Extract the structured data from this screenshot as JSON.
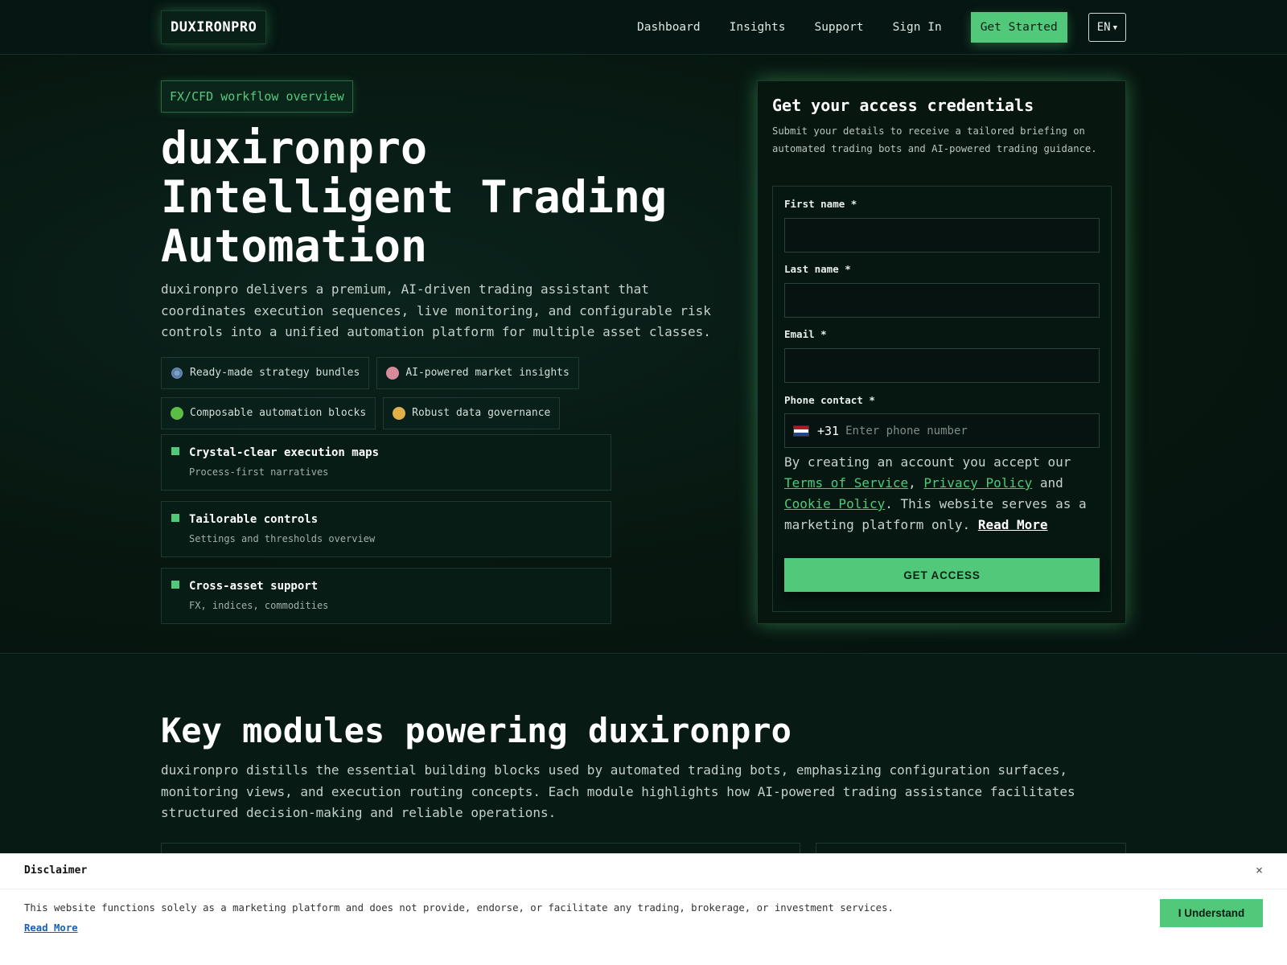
{
  "header": {
    "logo": "DUXIRONPRO",
    "nav": [
      "Dashboard",
      "Insights",
      "Support",
      "Sign In"
    ],
    "cta": "Get Started",
    "lang": "EN"
  },
  "hero": {
    "pill": "FX/CFD workflow overview",
    "title_lines": [
      "duxironpro",
      "Intelligent Trading",
      "Automation"
    ],
    "description": "duxironpro delivers a premium, AI-driven trading assistant that coordinates execution sequences, live monitoring, and configurable risk controls into a unified automation platform for multiple asset classes.",
    "chips": [
      {
        "icon": "gear-icon",
        "label": "Ready-made strategy bundles"
      },
      {
        "icon": "brain-icon",
        "label": "AI-powered market insights"
      },
      {
        "icon": "puzzle-icon",
        "label": "Composable automation blocks"
      },
      {
        "icon": "lock-icon",
        "label": "Robust data governance"
      }
    ],
    "features": [
      {
        "title": "Crystal-clear execution maps",
        "subtitle": "Process-first narratives"
      },
      {
        "title": "Tailorable controls",
        "subtitle": "Settings and thresholds overview"
      },
      {
        "title": "Cross-asset support",
        "subtitle": "FX, indices, commodities"
      }
    ]
  },
  "form": {
    "title": "Get your access credentials",
    "subtitle": "Submit your details to receive a tailored briefing on automated trading bots and AI-powered trading guidance.",
    "first_name_label": "First name *",
    "first_name_value": "",
    "last_name_label": "Last name *",
    "last_name_value": "",
    "email_label": "Email *",
    "email_value": "",
    "phone_label": "Phone contact *",
    "phone_prefix": "+31",
    "phone_placeholder": "Enter phone number",
    "legal_prefix": "By creating an account you accept our",
    "terms": "Terms of Service",
    "comma": ",",
    "privacy": "Privacy Policy",
    "and": "and",
    "cookie": "Cookie Policy",
    "legal_suffix": ". This website serves as a marketing platform only.",
    "read_more": "Read More",
    "submit": "GET ACCESS"
  },
  "modules": {
    "title": "Key modules powering duxironpro",
    "description": "duxironpro distills the essential building blocks used by automated trading bots, emphasizing configuration surfaces, monitoring views, and execution routing concepts. Each module highlights how AI-powered trading assistance facilitates structured decision-making and reliable operations."
  },
  "disclaimer": {
    "title": "Disclaimer",
    "close": "×",
    "text": "This website functions solely as a marketing platform and does not provide, endorse, or facilitate any trading, brokerage, or investment services.",
    "link": "Read More",
    "button": "I Understand"
  },
  "colors": {
    "accent": "#52c97a",
    "background": "#061612",
    "flag_red": "#ae1c28",
    "flag_white": "#ffffff",
    "flag_blue": "#21468b"
  }
}
